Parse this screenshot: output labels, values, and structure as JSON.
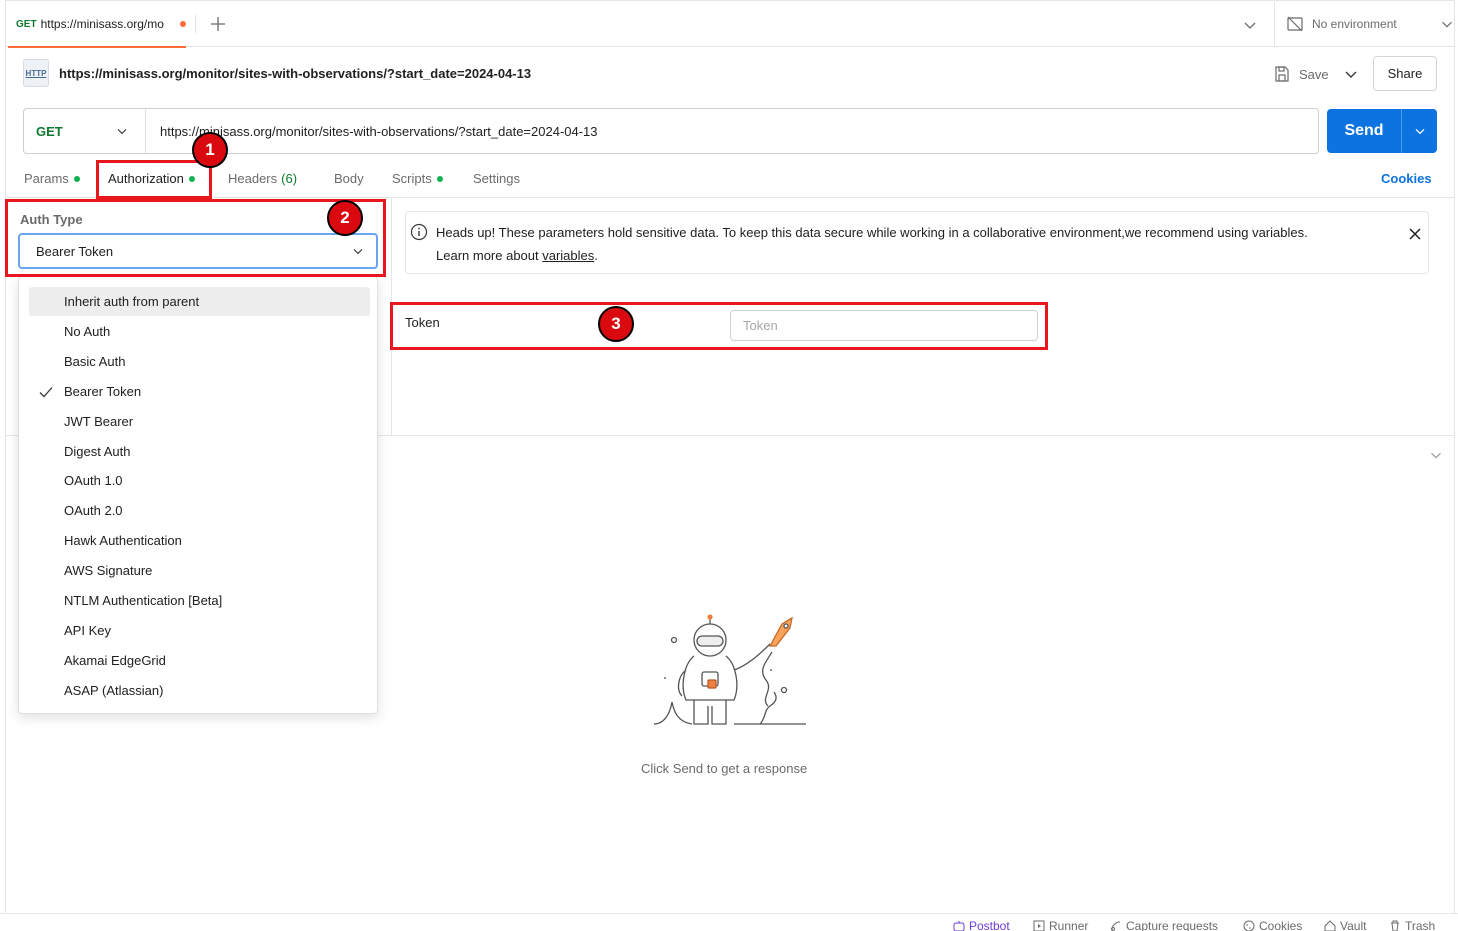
{
  "tab": {
    "method": "GET",
    "url_short": "https://minisass.org/mo"
  },
  "environment": {
    "label": "No environment"
  },
  "request": {
    "title": "https://minisass.org/monitor/sites-with-observations/?start_date=2024-04-13",
    "method": "GET",
    "url": "https://minisass.org/monitor/sites-with-observations/?start_date=2024-04-13",
    "http_badge": "HTTP"
  },
  "toolbar": {
    "save_label": "Save",
    "share_label": "Share",
    "send_label": "Send"
  },
  "request_tabs": {
    "params": "Params",
    "authorization": "Authorization",
    "headers": "Headers",
    "headers_count": "(6)",
    "body": "Body",
    "scripts": "Scripts",
    "settings": "Settings",
    "cookies": "Cookies"
  },
  "auth": {
    "type_label": "Auth Type",
    "selected": "Bearer Token",
    "options": [
      "Inherit auth from parent",
      "No Auth",
      "Basic Auth",
      "Bearer Token",
      "JWT Bearer",
      "Digest Auth",
      "OAuth 1.0",
      "OAuth 2.0",
      "Hawk Authentication",
      "AWS Signature",
      "NTLM Authentication [Beta]",
      "API Key",
      "Akamai EdgeGrid",
      "ASAP (Atlassian)"
    ]
  },
  "headsup": {
    "line1": "Heads up! These parameters hold sensitive data. To keep this data secure while working in a collaborative environment,we recommend using variables.",
    "line2_prefix": "Learn more about ",
    "line2_link": "variables",
    "line2_suffix": "."
  },
  "token": {
    "label": "Token",
    "placeholder": "Token",
    "value": ""
  },
  "response": {
    "message": "Click Send to get a response"
  },
  "annotations": {
    "badge1": "1",
    "badge2": "2",
    "badge3": "3"
  },
  "statusbar": {
    "postbot": "Postbot",
    "runner": "Runner",
    "capture": "Capture requests",
    "cookies": "Cookies",
    "vault": "Vault",
    "trash": "Trash"
  },
  "colors": {
    "accent": "#0c73e0",
    "get_method": "#0f7a2d",
    "annotation_red": "#e8161d",
    "unsaved_dot": "#ff6c37",
    "status_dot": "#0fb150"
  }
}
